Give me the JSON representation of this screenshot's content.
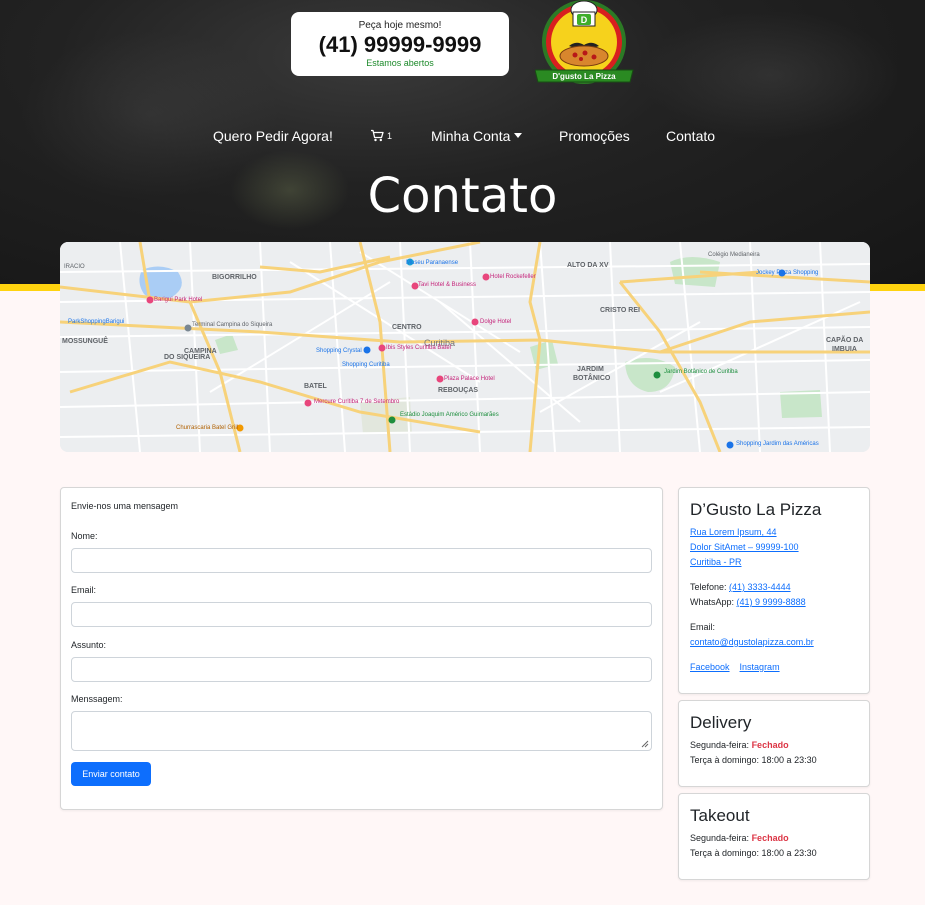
{
  "header": {
    "call_top": "Peça hoje mesmo!",
    "phone": "(41) 99999-9999",
    "status": "Estamos abertos",
    "logo_text": "D'gusto La Pizza",
    "logo_letter": "D"
  },
  "nav": {
    "order": "Quero Pedir Agora!",
    "cart_count": "1",
    "account": "Minha Conta",
    "promos": "Promoções",
    "contact": "Contato"
  },
  "page_title": "Contato",
  "map": {
    "labels": {
      "bigorrilho": "BIGORRILHO",
      "mossungue": "MOSSUNGUÊ",
      "campina": "CAMPINA",
      "do_siqueira": "DO SIQUEIRA",
      "centro": "CENTRO",
      "curitiba": "Curitiba",
      "batel": "BATEL",
      "reboucas": "REBOUÇAS",
      "alto_xv": "ALTO DA XV",
      "cristo_rei": "CRISTO REI",
      "jardim": "JARDIM",
      "botanico": "BOTÂNICO",
      "capao": "CAPÃO DA",
      "imbuia": "IMBUIA",
      "museu": "Museu Paranaense",
      "tavi": "Tavi Hotel & Business",
      "rockefeller": "Hotel Rockefeller",
      "barigui_hotel": "Barigui Park Hotel",
      "parkshopping": "ParkShoppingBarigui",
      "terminal": "Terminal Campina do Siqueira",
      "shopping_crystal": "Shopping Crystal",
      "ibis": "Ibis Styles Curitiba Batel",
      "shopping_curitiba": "Shopping Curitiba",
      "dolge": "Dolge Hotel",
      "plaza": "Plaza Palace Hotel",
      "mercure": "Mercure Curitiba 7 de Setembro",
      "estadio": "Estádio Joaquim Américo Guimarães",
      "churrascaria": "Churrascaria Batel Grill",
      "jardim_botanico": "Jardim Botânico de Curitiba",
      "colegio": "Colégio Medianeira",
      "jockey": "Jockey Plaza Shopping",
      "shopping_jardim": "Shopping Jardim das Américas",
      "cacique": "IRACIO"
    }
  },
  "form": {
    "heading": "Envie-nos uma mensagem",
    "name_label": "Nome:",
    "email_label": "Email:",
    "subject_label": "Assunto:",
    "message_label": "Menssagem:",
    "submit": "Enviar contato"
  },
  "info": {
    "title": "D’Gusto La Pizza",
    "address1": "Rua Lorem Ipsum, 44",
    "address2": "Dolor SitAmet – 99999-100",
    "address3": "Curitiba - PR",
    "phone_label": "Telefone:",
    "phone": "(41) 3333-4444",
    "whatsapp_label": "WhatsApp:",
    "whatsapp": "(41) 9 9999-8888",
    "email_label": "Email:",
    "email": "contato@dgustolapizza.com.br",
    "facebook": "Facebook",
    "instagram": "Instagram"
  },
  "delivery": {
    "title": "Delivery",
    "monday_label": "Segunda-feira:",
    "monday_value": "Fechado",
    "rest": "Terça à domingo: 18:00 a 23:30"
  },
  "takeout": {
    "title": "Takeout",
    "monday_label": "Segunda-feira:",
    "monday_value": "Fechado",
    "rest": "Terça à domingo: 18:00 a 23:30"
  },
  "colors": {
    "accent_yellow": "#ffd30f",
    "primary": "#0d6efd",
    "closed": "#dc3545",
    "status_green": "#1d8a2b"
  }
}
